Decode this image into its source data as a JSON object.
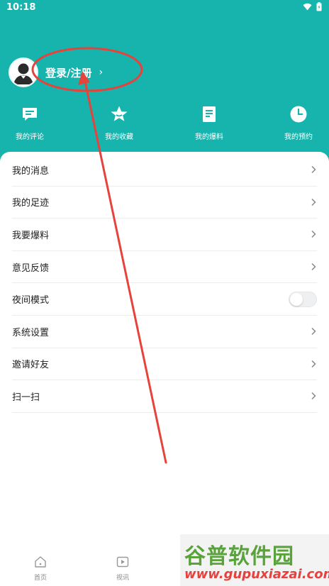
{
  "status_bar": {
    "time": "10:18"
  },
  "profile": {
    "login_label": "登录/注册",
    "chevron": "›"
  },
  "quick_actions": [
    {
      "label": "我的评论",
      "icon": "comment-icon"
    },
    {
      "label": "我的收藏",
      "icon": "star-icon"
    },
    {
      "label": "我的爆料",
      "icon": "document-icon"
    },
    {
      "label": "我的预约",
      "icon": "clock-icon"
    }
  ],
  "menu": [
    {
      "label": "我的消息",
      "type": "link"
    },
    {
      "label": "我的足迹",
      "type": "link"
    },
    {
      "label": "我要爆料",
      "type": "link"
    },
    {
      "label": "意见反馈",
      "type": "link"
    },
    {
      "label": "夜间模式",
      "type": "toggle",
      "on": false
    },
    {
      "label": "系统设置",
      "type": "link"
    },
    {
      "label": "邀请好友",
      "type": "link"
    },
    {
      "label": "扫一扫",
      "type": "link"
    }
  ],
  "bottom_nav": [
    {
      "label": "首页",
      "icon": "home-icon"
    },
    {
      "label": "视讯",
      "icon": "video-icon"
    }
  ],
  "watermark": {
    "title": "谷普软件园",
    "url": "www.gupuxiazai.com"
  },
  "colors": {
    "brand": "#17b3ad",
    "annotation": "#e5433b"
  }
}
